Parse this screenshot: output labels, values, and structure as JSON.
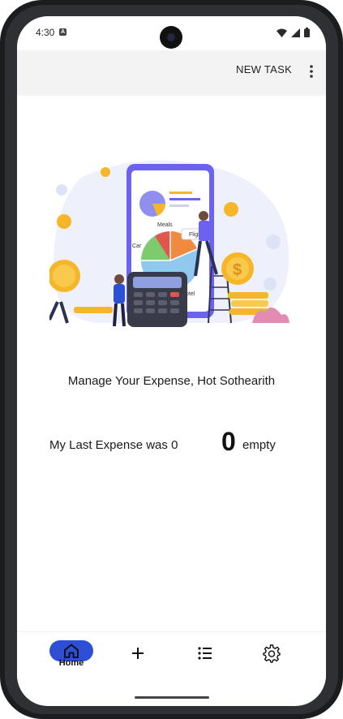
{
  "status_bar": {
    "time": "4:30"
  },
  "app_bar": {
    "action_label": "NEW TASK"
  },
  "illustration": {
    "labels": {
      "meals": "Meals",
      "car": "Car",
      "flight": "Flight",
      "hotel": "Hotel",
      "dollar": "$"
    }
  },
  "main": {
    "greeting": "Manage Your Expense, Hot Sothearith",
    "last_expense_label": "My Last Expense was 0",
    "last_expense_value": "0",
    "last_expense_suffix": "empty"
  },
  "bottom_nav": {
    "items": [
      {
        "label": "Home",
        "icon": "home-icon",
        "active": true
      },
      {
        "label": "",
        "icon": "plus-icon"
      },
      {
        "label": "",
        "icon": "list-icon"
      },
      {
        "label": "",
        "icon": "gear-icon"
      }
    ]
  },
  "colors": {
    "accent": "#2c4fd6",
    "app_bar_bg": "#f3f3f3",
    "coin": "#f6b62a",
    "chart_blue": "#8fc9ef",
    "chart_green": "#7ecb6e",
    "chart_orange": "#f08a3e",
    "chart_red": "#e2554c",
    "phone_purple": "#6b63f0"
  }
}
